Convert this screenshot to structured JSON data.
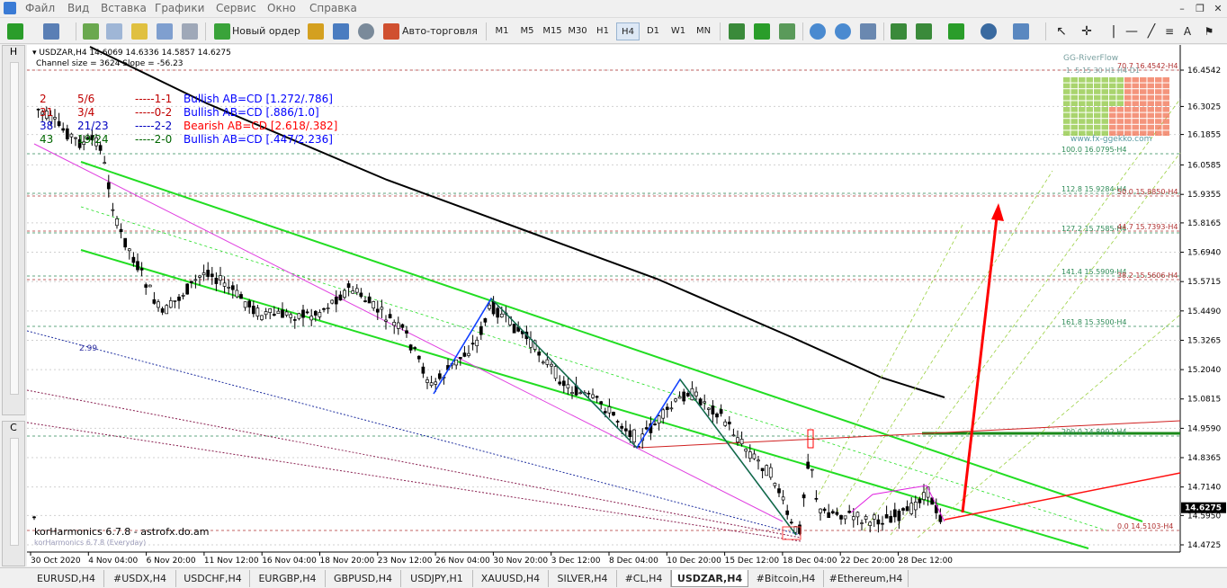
{
  "menu": {
    "items": [
      "Файл",
      "Вид",
      "Вставка",
      "Графики",
      "Сервис",
      "Окно",
      "Справка"
    ]
  },
  "toolbar": {
    "new_order": "Новый ордер",
    "autotrade": "Авто-торговля",
    "timeframes": [
      "M1",
      "M5",
      "M15",
      "M30",
      "H1",
      "H4",
      "D1",
      "W1",
      "MN"
    ],
    "active_timeframe": "H4"
  },
  "chart": {
    "header_line1": "USDZAR,H4  14.6069 14.6336 14.5857 14.6275",
    "header_line2": "Channel size = 3624 Slope = -56.23",
    "current_price": "14.6275",
    "footer_label": "korHarmonics 6.7.8 - astrofx.do.am",
    "footer_label_sub": "korHarmonics 6.7.8 (Everyday)",
    "watermark_line1": "GG-RiverFlow",
    "watermark_line2": "1.  5:15  30  H1  H4  D1",
    "watermark_url": "www.fx-ggekko.com",
    "left_marker_299": "2.99"
  },
  "harmonics_table": [
    {
      "c1": "2",
      "c2": "5/6",
      "c3": "1-1",
      "label": "Bullish AB=CD [1.272/.786]",
      "color": "#0000ff",
      "c1color": "#c00000"
    },
    {
      "c1": "31",
      "c2": "3/4",
      "c3": "0-2",
      "label": "Bullish AB=CD [.886/1.0]",
      "color": "#0000ff",
      "c1color": "#c00000"
    },
    {
      "c1": "38",
      "c2": "21/23",
      "c3": "2-2",
      "label": "Bearish AB=CD [2.618/.382]",
      "color": "#ff0000",
      "c1color": "#0000c0"
    },
    {
      "c1": "43",
      "c2": "19/24",
      "c3": "2-0",
      "label": "Bullish AB=CD [.447/2.236]",
      "color": "#0000ff",
      "c1color": "#006600"
    }
  ],
  "price_axis": [
    "16.4542",
    "16.3025",
    "16.1855",
    "16.0585",
    "15.9355",
    "15.8165",
    "15.6940",
    "15.5715",
    "15.4490",
    "15.3265",
    "15.2040",
    "15.0815",
    "14.9590",
    "14.8365",
    "14.7140",
    "14.5950",
    "14.4725"
  ],
  "date_axis": [
    "30 Oct 2020",
    "4 Nov 04:00",
    "6 Nov 20:00",
    "11 Nov 12:00",
    "16 Nov 04:00",
    "18 Nov 20:00",
    "23 Nov 12:00",
    "26 Nov 04:00",
    "30 Nov 20:00",
    "3 Dec 12:00",
    "8 Dec 04:00",
    "10 Dec 20:00",
    "15 Dec 12:00",
    "18 Dec 04:00",
    "22 Dec 20:00",
    "28 Dec 12:00"
  ],
  "fib_levels": [
    {
      "label": "70.7",
      "price": "16.4542-H4",
      "color": "#b03030"
    },
    {
      "label": "100.0",
      "price": "16.0795-H4",
      "color": "#2e8b57"
    },
    {
      "label": "112.8",
      "price": "15.9284-H4",
      "color": "#2e8b57"
    },
    {
      "label": "50.0",
      "price": "15.8850-H4",
      "color": "#b03030"
    },
    {
      "label": "127.2",
      "price": "15.7585-H4",
      "color": "#2e8b57"
    },
    {
      "label": "44.7",
      "price": "15.7393-H4",
      "color": "#b03030"
    },
    {
      "label": "141.4",
      "price": "15.5909-H4",
      "color": "#2e8b57"
    },
    {
      "label": "38.2",
      "price": "15.5606-H4",
      "color": "#b03030"
    },
    {
      "label": "161.8",
      "price": "15.3500-H4",
      "color": "#2e8b57"
    },
    {
      "label": "200.0",
      "price": "14.8992-H4",
      "color": "#2e8b57"
    },
    {
      "label": "0.0",
      "price": "14.5103-H4",
      "color": "#b03030"
    }
  ],
  "tabs": [
    "EURUSD,H4",
    "#USDX,H4",
    "USDCHF,H4",
    "EURGBP,H4",
    "GBPUSD,H4",
    "USDJPY,H1",
    "XAUUSD,H4",
    "SILVER,H4",
    "#CL,H4",
    "USDZAR,H4",
    "#Bitcoin,H4",
    "#Ethereum,H4"
  ],
  "active_tab": "USDZAR,H4",
  "colors": {
    "chart_bg": "#ffffff",
    "grid": "#c8c8c8",
    "channel": "#00e000",
    "ma": "#000000",
    "arrow": "#ff0000",
    "bull_pattern": "#0000ff"
  }
}
